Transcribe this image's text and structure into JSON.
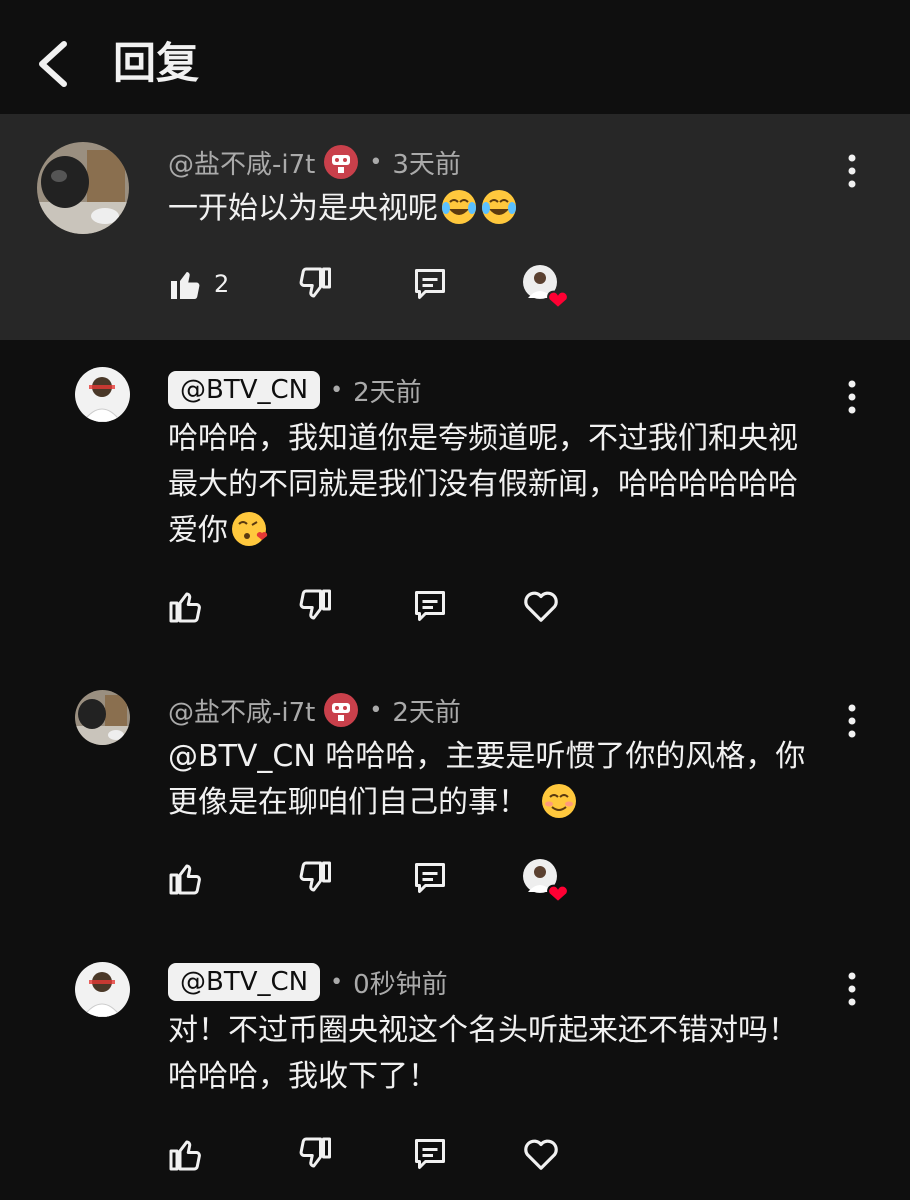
{
  "header": {
    "title": "回复"
  },
  "comments": [
    {
      "author": "@盐不咸-i7t",
      "time": "3天前",
      "text": "一开始以为是央视呢",
      "likes": "2"
    },
    {
      "author": "@BTV_CN",
      "time": "2天前",
      "text_lines": [
        "哈哈哈，我知道你是夸频道呢，不过我们和央视",
        "最大的不同就是我们没有假新闻，哈哈哈哈哈哈",
        "爱你"
      ]
    },
    {
      "author": "@盐不咸-i7t",
      "time": "2天前",
      "text_lines": [
        "@BTV_CN 哈哈哈，主要是听惯了你的风格，你",
        "更像是在聊咱们自己的事！"
      ]
    },
    {
      "author": "@BTV_CN",
      "time": "0秒钟前",
      "text_lines": [
        "对！不过币圈央视这个名头听起来还不错对吗！",
        "哈哈哈，我收下了！"
      ]
    }
  ],
  "colors": {
    "background": "#0f0f0f",
    "highlight": "#272727",
    "heart": "#ff0033",
    "badge": "#c9404b"
  },
  "icons": [
    "back-arrow-icon",
    "more-vert-icon",
    "thumb-up-icon",
    "thumb-down-icon",
    "reply-icon",
    "heart-icon",
    "creator-heart-icon",
    "tears-of-joy-emoji",
    "kiss-emoji",
    "smile-emoji"
  ]
}
